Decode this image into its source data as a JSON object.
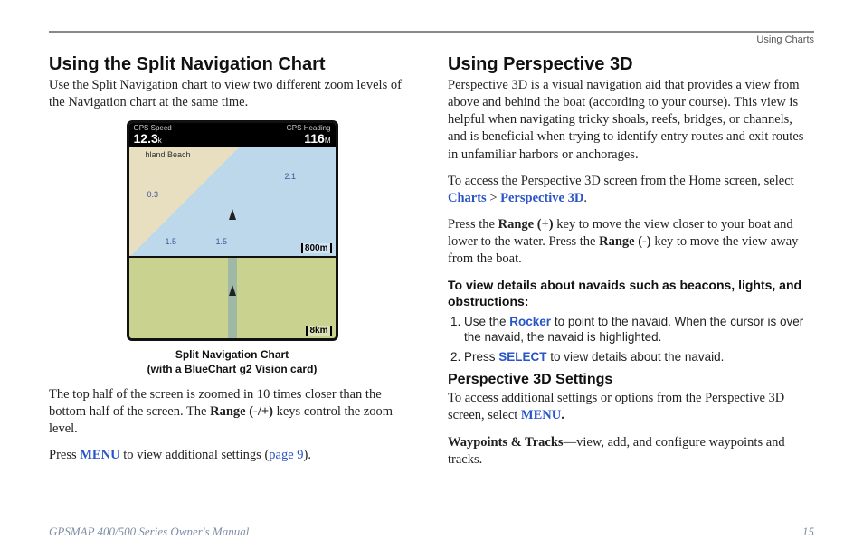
{
  "header": {
    "section_name": "Using Charts"
  },
  "left": {
    "h2": "Using the Split Navigation Chart",
    "intro": "Use the Split Navigation chart to view two different zoom levels of the Navigation chart at the same time.",
    "caption_line1": "Split Navigation Chart",
    "caption_line2": "(with a BlueChart g2 Vision card)",
    "para2_a": "The top half of the screen is zoomed in 10 times closer than the bottom half of the screen. The ",
    "para2_range": "Range (-/+)",
    "para2_b": " keys control the zoom level.",
    "para3_a": "Press ",
    "para3_menu": "MENU",
    "para3_b": " to view additional settings (",
    "para3_link": "page 9",
    "para3_c": ").",
    "screenshot": {
      "gps_speed_label": "GPS Speed",
      "gps_speed_value": "12.3",
      "gps_speed_unit": "k",
      "gps_heading_label": "GPS Heading",
      "gps_heading_value": "116",
      "gps_heading_unit": "M",
      "beach_label": "hland Beach",
      "depths_top": [
        "0.3",
        "1.5",
        "1.5",
        "2.1"
      ],
      "scale_top": "800m",
      "scale_bottom": "8km"
    }
  },
  "right": {
    "h2": "Using Perspective 3D",
    "intro": "Perspective 3D is a visual navigation aid that provides a view from above and behind the boat (according to your course). This view is helpful when navigating tricky shoals, reefs, bridges, or channels, and is beneficial when trying to identify entry routes and exit routes in unfamiliar harbors or anchorages.",
    "access_a": "To access the Perspective 3D screen from the Home screen, select ",
    "access_charts": "Charts",
    "access_gt": " > ",
    "access_p3d": "Perspective 3D",
    "access_b": ".",
    "range_a": "Press the ",
    "range_plus": "Range (+)",
    "range_b": " key to move the view closer to your boat and lower to the water. Press the ",
    "range_minus": "Range (-)",
    "range_c": " key to move the view away from the boat.",
    "navaids_heading": "To view details about navaids such as beacons, lights, and obstructions:",
    "step1_a": "Use the ",
    "step1_rocker": "Rocker",
    "step1_b": " to point to the navaid. When the cursor is over the navaid, the navaid is highlighted.",
    "step2_a": "Press ",
    "step2_select": "SELECT",
    "step2_b": " to view details about the navaid.",
    "h3": "Perspective 3D Settings",
    "settings_a": "To access additional settings or options from the Perspective 3D screen, select ",
    "settings_menu": "MENU",
    "settings_b": ".",
    "wpt_label": "Waypoints & Tracks",
    "wpt_text": "—view, add, and configure waypoints and tracks."
  },
  "footer": {
    "manual": "GPSMAP 400/500 Series Owner's Manual",
    "page": "15"
  }
}
